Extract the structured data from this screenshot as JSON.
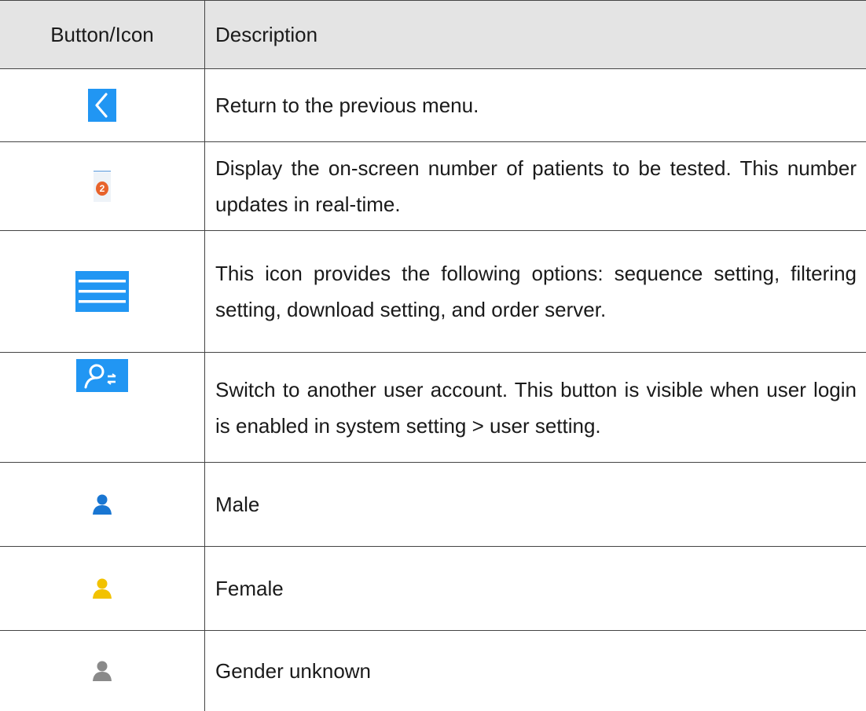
{
  "table": {
    "headers": {
      "icon": "Button/Icon",
      "description": "Description"
    },
    "rows": [
      {
        "icon": "back-chevron-icon",
        "description": "Return to the previous menu."
      },
      {
        "icon": "patient-count-badge-icon",
        "badge_value": "2",
        "description": "Display the on-screen number of patients to be tested. This number updates in real-time."
      },
      {
        "icon": "hamburger-menu-icon",
        "description": "This icon provides the following options: sequence setting, filtering setting, download setting, and order server."
      },
      {
        "icon": "switch-user-icon",
        "description": "Switch to another user account. This button is visible when user login is enabled in system setting > user setting."
      },
      {
        "icon": "male-user-icon",
        "description": "Male"
      },
      {
        "icon": "female-user-icon",
        "description": "Female"
      },
      {
        "icon": "unknown-gender-user-icon",
        "description": "Gender unknown"
      }
    ]
  },
  "colors": {
    "accent_blue": "#2196f3",
    "badge_orange": "#e8632b",
    "male_blue": "#1976d2",
    "female_yellow": "#f2c200",
    "unknown_gray": "#8a8a8a",
    "header_bg": "#e4e4e4"
  }
}
